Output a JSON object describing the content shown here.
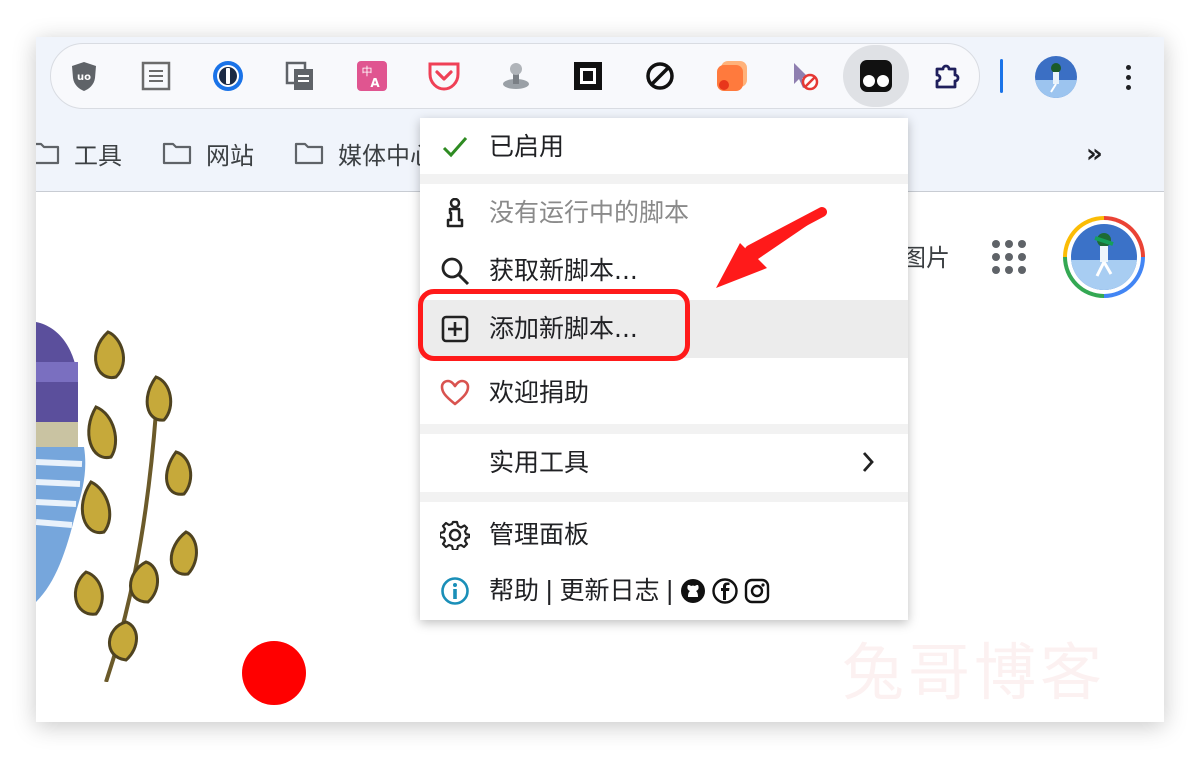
{
  "toolbar": {
    "extensions": [
      "ublock-origin-icon",
      "reader-mode-icon",
      "1password-icon",
      "clipboard-copy-icon",
      "translate-icon",
      "pocket-icon",
      "joystick-icon",
      "square-frame-icon",
      "blocked-circle-icon",
      "orange-app-icon",
      "cursor-block-icon",
      "tampermonkey-icon",
      "extensions-puzzle-icon"
    ],
    "active_extension": "tampermonkey-icon",
    "menu_icon": "more-vert-icon"
  },
  "bookmarks": {
    "items": [
      {
        "label": "工具"
      },
      {
        "label": "网站"
      },
      {
        "label": "媒体中心"
      }
    ],
    "overflow_label": "»"
  },
  "page": {
    "images_link": "图片",
    "apps_icon": "google-apps-icon",
    "watermark": "兔哥博客"
  },
  "menu": {
    "enabled": {
      "label": "已启用",
      "icon": "check-icon"
    },
    "no_scripts": {
      "label": "没有运行中的脚本",
      "icon": "info-pawn-icon"
    },
    "get_new": {
      "label": "获取新脚本...",
      "icon": "search-icon"
    },
    "add_new": {
      "label": "添加新脚本...",
      "icon": "plus-square-icon"
    },
    "donate": {
      "label": "欢迎捐助",
      "icon": "heart-icon"
    },
    "utilities": {
      "label": "实用工具",
      "icon": "chevron-right-icon"
    },
    "dashboard": {
      "label": "管理面板",
      "icon": "gear-icon"
    },
    "help": {
      "label": "帮助",
      "sep": "|",
      "changelog": "更新日志",
      "icon": "info-circle-icon",
      "social": [
        "github-icon",
        "facebook-icon",
        "instagram-icon"
      ]
    }
  },
  "colors": {
    "highlight_box": "#ff1a1a",
    "arrow": "#ff1a1a",
    "check": "#2e8b22",
    "heart": "#d9534f",
    "info": "#1a8fb8",
    "accent": "#1a73e8"
  }
}
